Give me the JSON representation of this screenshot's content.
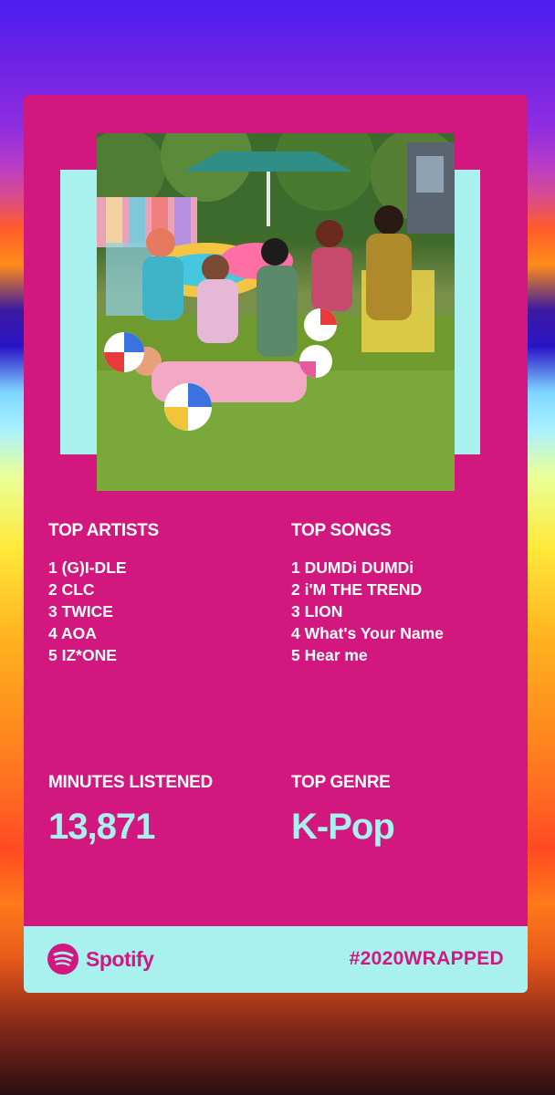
{
  "colors": {
    "card": "#d2177f",
    "accent": "#a9f1ef",
    "text": "#ffffff"
  },
  "photo": {
    "alt_icon": "group-photo"
  },
  "top_artists": {
    "title": "TOP ARTISTS",
    "items": [
      "1 (G)I-DLE",
      "2 CLC",
      "3 TWICE",
      "4 AOA",
      "5 IZ*ONE"
    ]
  },
  "top_songs": {
    "title": "TOP SONGS",
    "items": [
      "1 DUMDi DUMDi",
      "2 i'M THE TREND",
      "3 LION",
      "4 What's Your Name",
      "5 Hear me"
    ]
  },
  "minutes": {
    "title": "MINUTES LISTENED",
    "value": "13,871"
  },
  "genre": {
    "title": "TOP GENRE",
    "value": "K-Pop"
  },
  "footer": {
    "brand": "Spotify",
    "hashtag": "#2020WRAPPED"
  }
}
